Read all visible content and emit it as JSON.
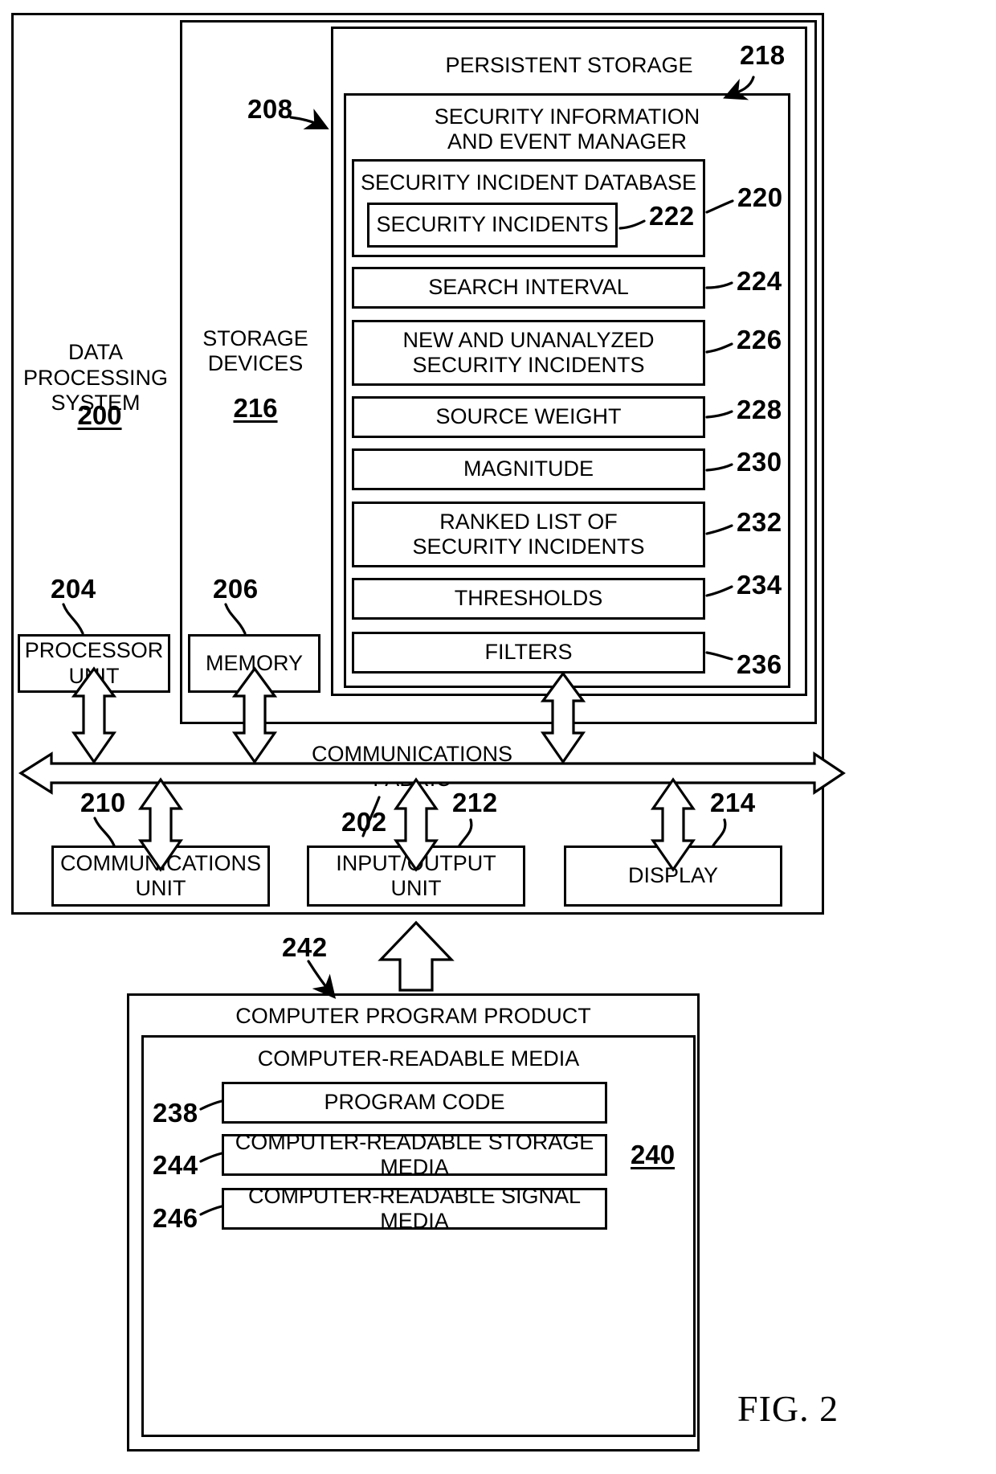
{
  "figure": {
    "label": "FIG. 2",
    "outer_system": {
      "title": "DATA PROCESSING SYSTEM",
      "ref": "200"
    },
    "storage_devices": {
      "title": "STORAGE DEVICES",
      "ref": "216"
    },
    "persistent_storage": {
      "title": "PERSISTENT STORAGE",
      "ref": "208",
      "arrow_ref": "218"
    },
    "siem": {
      "title": "SECURITY INFORMATION AND EVENT MANAGER",
      "line1": "SECURITY INFORMATION",
      "line2": "AND EVENT MANAGER",
      "ref": "218"
    },
    "security_incident_database": {
      "title": "SECURITY INCIDENT DATABASE",
      "ref": "220",
      "inner": {
        "title": "SECURITY INCIDENTS",
        "ref": "222"
      }
    },
    "siem_items": [
      {
        "label": "SEARCH INTERVAL",
        "ref": "224",
        "lines": [
          "SEARCH INTERVAL"
        ]
      },
      {
        "label": "NEW AND UNANALYZED SECURITY INCIDENTS",
        "ref": "226",
        "lines": [
          "NEW AND UNANALYZED",
          "SECURITY INCIDENTS"
        ]
      },
      {
        "label": "SOURCE WEIGHT",
        "ref": "228",
        "lines": [
          "SOURCE WEIGHT"
        ]
      },
      {
        "label": "MAGNITUDE",
        "ref": "230",
        "lines": [
          "MAGNITUDE"
        ]
      },
      {
        "label": "RANKED LIST OF SECURITY INCIDENTS",
        "ref": "232",
        "lines": [
          "RANKED LIST OF",
          "SECURITY INCIDENTS"
        ]
      },
      {
        "label": "THRESHOLDS",
        "ref": "234",
        "lines": [
          "THRESHOLDS"
        ]
      },
      {
        "label": "FILTERS",
        "ref": "236",
        "lines": [
          "FILTERS"
        ]
      }
    ],
    "processor_unit": {
      "line1": "PROCESSOR",
      "line2": "UNIT",
      "ref": "204"
    },
    "memory": {
      "line1": "MEMORY",
      "ref": "206"
    },
    "communications_fabric": {
      "label": "COMMUNICATIONS FABRIC",
      "ref": "202"
    },
    "communications_unit": {
      "line1": "COMMUNICATIONS",
      "line2": "UNIT",
      "ref": "210"
    },
    "io_unit": {
      "line1": "INPUT/OUTPUT",
      "line2": "UNIT",
      "ref": "212"
    },
    "display": {
      "line1": "DISPLAY",
      "ref": "214"
    },
    "computer_program_product": {
      "title": "COMPUTER PROGRAM PRODUCT",
      "ref": "242"
    },
    "computer_readable_media": {
      "title": "COMPUTER-READABLE MEDIA",
      "ref": "240"
    },
    "media_items": [
      {
        "label": "PROGRAM CODE",
        "ref": "238"
      },
      {
        "label": "COMPUTER-READABLE STORAGE MEDIA",
        "ref": "244"
      },
      {
        "label": "COMPUTER-READABLE SIGNAL MEDIA",
        "ref": "246"
      }
    ]
  },
  "colors": {
    "line": "#000000",
    "background": "#ffffff"
  }
}
